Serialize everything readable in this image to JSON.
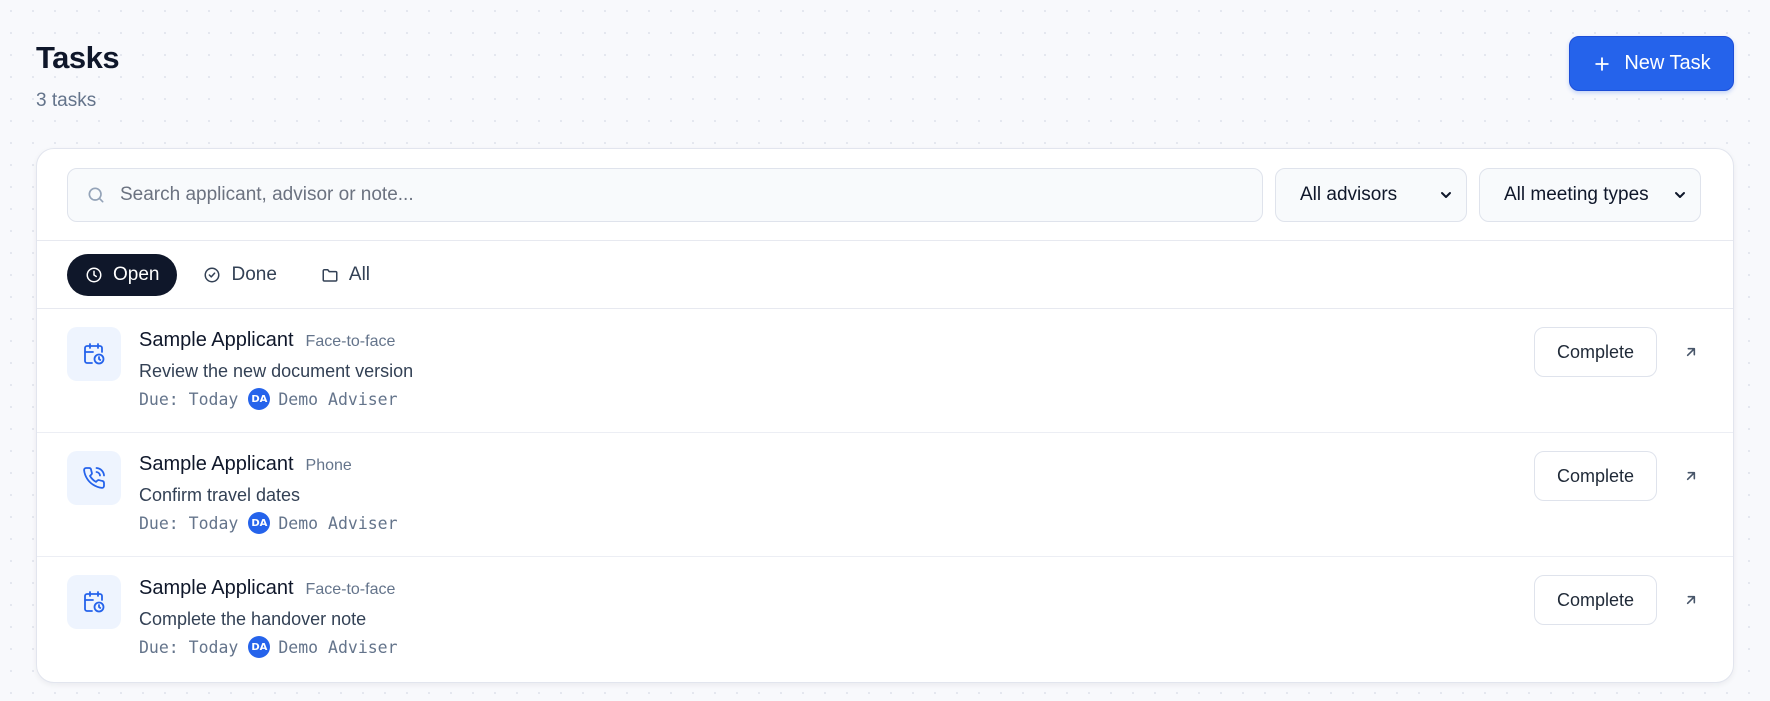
{
  "header": {
    "title": "Tasks",
    "subtitle": "3 tasks",
    "new_task_label": "New Task"
  },
  "filters": {
    "search_placeholder": "Search applicant, advisor or note...",
    "advisor_select": "All advisors",
    "meeting_type_select": "All meeting types"
  },
  "tabs": [
    {
      "label": "Open",
      "icon": "clock-icon",
      "active": true
    },
    {
      "label": "Done",
      "icon": "check-circle-icon",
      "active": false
    },
    {
      "label": "All",
      "icon": "folder-icon",
      "active": false
    }
  ],
  "tasks": [
    {
      "applicant": "Sample Applicant",
      "meeting_type": "Face-to-face",
      "icon": "calendar-clock-icon",
      "note": "Review the new document version",
      "due": "Due: Today",
      "adviser_initials": "DA",
      "adviser": "Demo Adviser",
      "action_label": "Complete"
    },
    {
      "applicant": "Sample Applicant",
      "meeting_type": "Phone",
      "icon": "phone-icon",
      "note": "Confirm travel dates",
      "due": "Due: Today",
      "adviser_initials": "DA",
      "adviser": "Demo Adviser",
      "action_label": "Complete"
    },
    {
      "applicant": "Sample Applicant",
      "meeting_type": "Face-to-face",
      "icon": "calendar-clock-icon",
      "note": "Complete the handover note",
      "due": "Due: Today",
      "adviser_initials": "DA",
      "adviser": "Demo Adviser",
      "action_label": "Complete"
    }
  ],
  "colors": {
    "accent": "#2563eb",
    "active_tab": "#0f172a",
    "icon_tile": "#eef4fe"
  }
}
